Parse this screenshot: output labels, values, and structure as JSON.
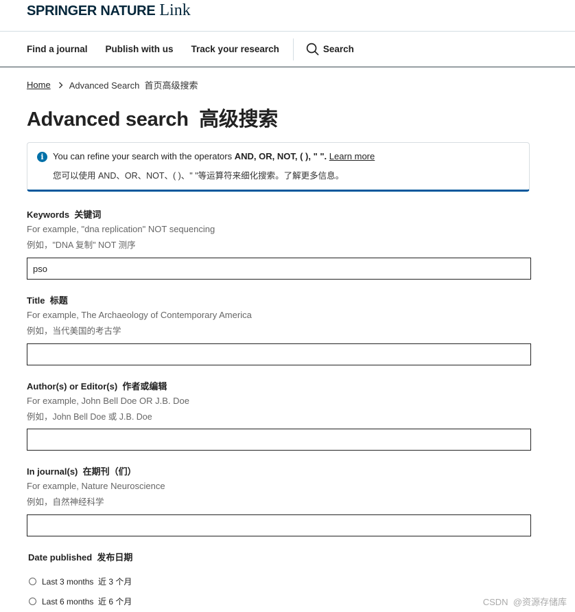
{
  "header": {
    "logo_brand": "SPRINGER NATURE",
    "logo_link": "Link",
    "nav": [
      "Find a journal",
      "Publish with us",
      "Track your research"
    ],
    "search_label": "Search"
  },
  "breadcrumb": {
    "home": "Home",
    "current": "Advanced Search  首页高级搜索"
  },
  "page_title": "Advanced search  高级搜索",
  "info": {
    "line1_prefix": "You can refine your search with the operators ",
    "line1_ops": "AND, OR, NOT, ( ), \" \".",
    "learn_more": "Learn more",
    "line2": "您可以使用 AND、OR、NOT、( )、\" \"等运算符来细化搜索。了解更多信息。"
  },
  "fields": {
    "keywords": {
      "label": "Keywords  关键词",
      "hint": "For example, \"dna replication\" NOT sequencing",
      "hint_cn": "例如，\"DNA 复制\" NOT 测序",
      "value": "pso"
    },
    "title": {
      "label": "Title  标题",
      "hint": "For example, The Archaeology of Contemporary America",
      "hint_cn": "例如，当代美国的考古学",
      "value": ""
    },
    "authors": {
      "label": "Author(s) or Editor(s)  作者或编辑",
      "hint": "For example, John Bell Doe OR J.B. Doe",
      "hint_cn": "例如，John Bell Doe 或 J.B. Doe",
      "value": ""
    },
    "journals": {
      "label": "In journal(s)  在期刊（们）",
      "hint": "For example, Nature Neuroscience",
      "hint_cn": "例如，自然神经科学",
      "value": ""
    }
  },
  "date_published": {
    "label": "Date published  发布日期",
    "options": [
      "Last 3 months  近 3 个月",
      "Last 6 months  近 6 个月"
    ]
  },
  "watermark": "CSDN  @资源存储库",
  "colors": {
    "brand": "#04263a",
    "accent_blue": "#01579b",
    "info_icon": "#0070a8"
  }
}
